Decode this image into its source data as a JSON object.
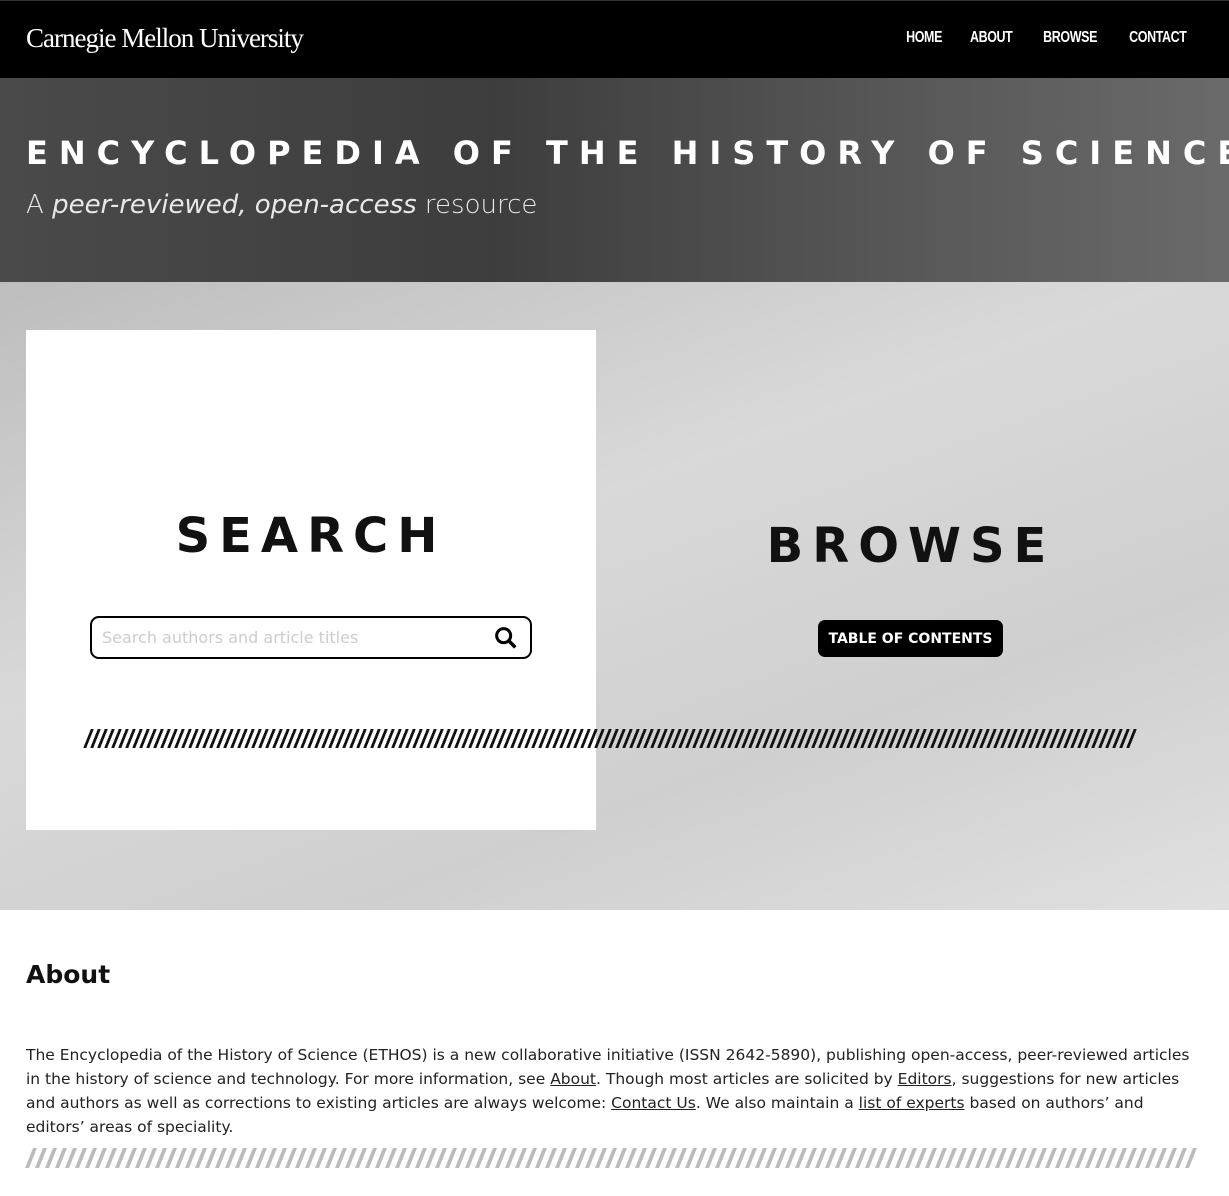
{
  "header": {
    "logo": "Carnegie Mellon University",
    "nav": [
      "HOME",
      "ABOUT",
      "BROWSE",
      "CONTACT"
    ]
  },
  "hero": {
    "title": "ENCYCLOPEDIA OF THE HISTORY OF SCIENCE",
    "subtitle_pre": "A ",
    "subtitle_em": "peer-reviewed, open-access",
    "subtitle_post": " resource"
  },
  "search": {
    "heading": "SEARCH",
    "placeholder": "Search authors and article titles",
    "icon": "search-icon"
  },
  "browse": {
    "heading": "BROWSE",
    "button": "TABLE OF CONTENTS"
  },
  "about": {
    "heading": "About",
    "t1": "The Encyclopedia of the History of Science (ETHOS) is a new collaborative initiative (ISSN 2642-5890), publishing open-access, peer-reviewed articles in the history of science and technology. For more information, see ",
    "l1": "About",
    "t2": ". Though most articles are solicited by ",
    "l2": "Editors",
    "t3": ", suggestions for new articles and authors as well as corrections to existing articles are always welcome: ",
    "l3": "Contact Us",
    "t4": ". We also maintain a ",
    "l4": "list of experts",
    "t5": " based on authors’ and editors’ areas of speciality."
  }
}
